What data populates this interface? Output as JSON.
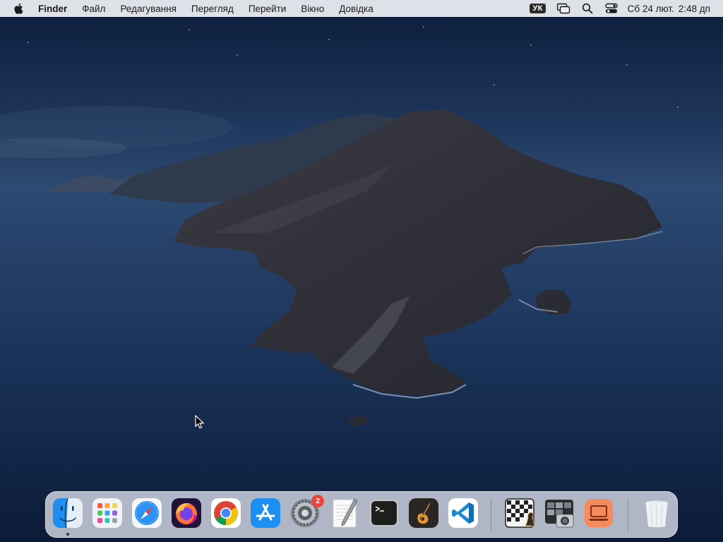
{
  "menubar": {
    "app_name": "Finder",
    "items": [
      "Файл",
      "Редагування",
      "Перегляд",
      "Перейти",
      "Вікно",
      "Довідка"
    ],
    "input_source": "УК",
    "date": "Сб 24 лют.",
    "time": "2:48 дп",
    "status_icons": [
      "screen-mirroring-icon",
      "search-icon",
      "control-center-icon"
    ]
  },
  "dock": {
    "apps": [
      {
        "name": "Finder",
        "icon": "finder-icon",
        "running": true
      },
      {
        "name": "Launchpad",
        "icon": "launchpad-icon"
      },
      {
        "name": "Safari",
        "icon": "safari-icon"
      },
      {
        "name": "Firefox",
        "icon": "firefox-icon"
      },
      {
        "name": "Google Chrome",
        "icon": "chrome-icon"
      },
      {
        "name": "App Store",
        "icon": "app-store-icon"
      },
      {
        "name": "System Preferences",
        "icon": "system-preferences-icon",
        "badge": "2"
      },
      {
        "name": "TextEdit",
        "icon": "textedit-icon"
      },
      {
        "name": "Terminal",
        "icon": "terminal-icon"
      },
      {
        "name": "GarageBand",
        "icon": "garageband-icon"
      },
      {
        "name": "Visual Studio Code",
        "icon": "vscode-icon"
      },
      {
        "name": "Chess",
        "icon": "chess-icon"
      },
      {
        "name": "Screenshot",
        "icon": "screenshot-icon"
      },
      {
        "name": "Remote Desktop",
        "icon": "remote-desktop-icon"
      },
      {
        "name": "Trash",
        "icon": "trash-icon"
      }
    ],
    "colors": {
      "badge": "#f0433a",
      "terminal_bg": "#1e1e1e",
      "vscode_blue": "#1f8ad2"
    }
  },
  "wallpaper": {
    "name": "macOS Catalina"
  }
}
